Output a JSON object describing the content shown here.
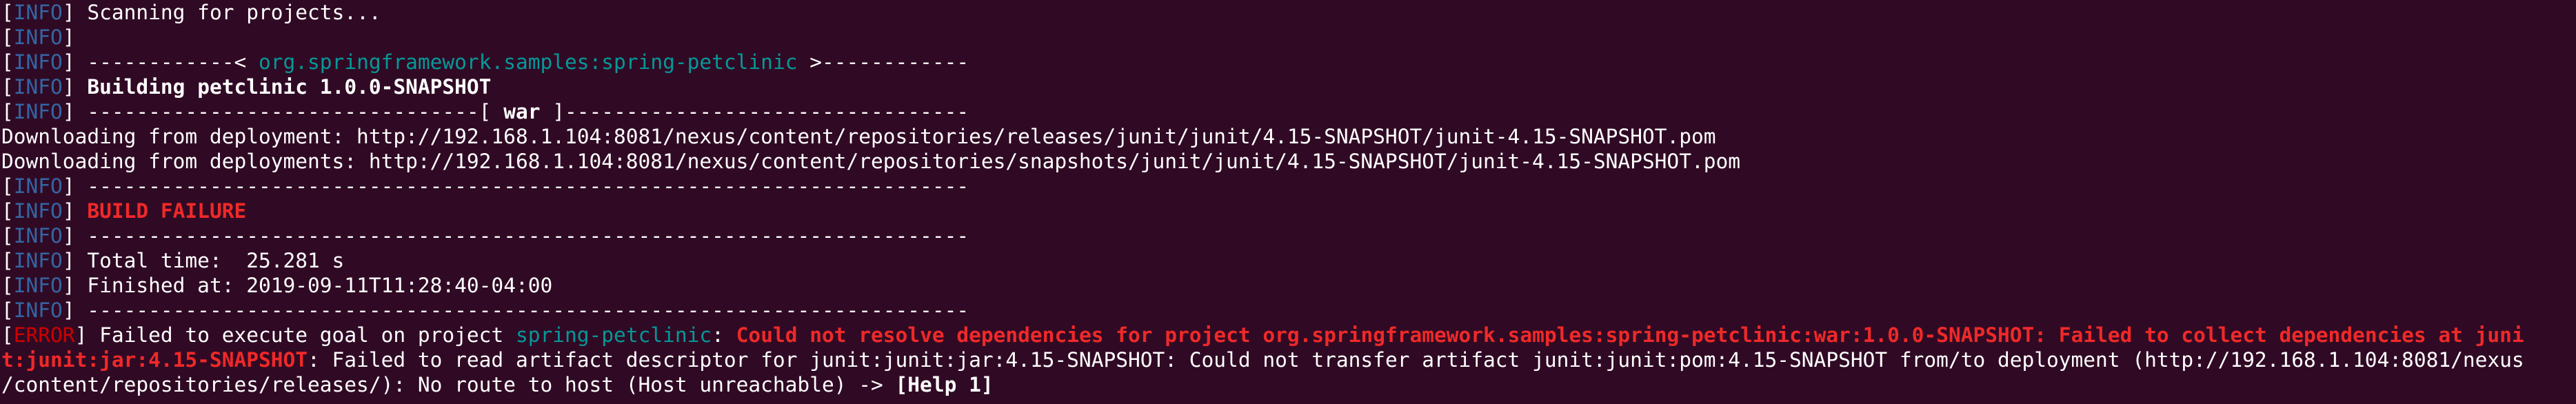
{
  "levels": {
    "info": "INFO",
    "error": "ERROR"
  },
  "colors": {
    "background": "#300a24",
    "info": "#3465a4",
    "error": "#cc0000",
    "cyan": "#06989a",
    "error_bold": "#ef2929"
  },
  "lines": {
    "l0_text": " Scanning for projects...",
    "l1_text": "",
    "l2_dash_a": " ------------< ",
    "l2_artifact": "org.springframework.samples:spring-petclinic",
    "l2_dash_b": " >------------",
    "l3_prefix": " ",
    "l3_bold": "Building petclinic 1.0.0-SNAPSHOT",
    "l4_dash_a": " --------------------------------[ ",
    "l4_war": "war",
    "l4_dash_b": " ]---------------------------------",
    "l5_text": "Downloading from deployment: http://192.168.1.104:8081/nexus/content/repositories/releases/junit/junit/4.15-SNAPSHOT/junit-4.15-SNAPSHOT.pom",
    "l6_text": "Downloading from deployments: http://192.168.1.104:8081/nexus/content/repositories/snapshots/junit/junit/4.15-SNAPSHOT/junit-4.15-SNAPSHOT.pom",
    "l7_text": " ------------------------------------------------------------------------",
    "l8_prefix": " ",
    "l8_bold": "BUILD FAILURE",
    "l9_text": " ------------------------------------------------------------------------",
    "l10_text": " Total time:  25.281 s",
    "l11_text": " Finished at: 2019-09-11T11:28:40-04:00",
    "l12_text": " ------------------------------------------------------------------------",
    "l13_a": " Failed to execute goal on project ",
    "l13_project": "spring-petclinic",
    "l13_b": ": ",
    "l13_bold": "Could not resolve dependencies for project org.springframework.samples:spring-petclinic:war:1.0.0-SNAPSHOT: Failed to collect dependencies at juni",
    "l14_bold": "t:junit:jar:4.15-SNAPSHOT",
    "l14_text": ": Failed to read artifact descriptor for junit:junit:jar:4.15-SNAPSHOT: Could not transfer artifact junit:junit:pom:4.15-SNAPSHOT from/to deployment (http://192.168.1.104:8081/nexus",
    "l15_text": "/content/repositories/releases/): No route to host (Host unreachable) -> ",
    "l15_help": "[Help 1]"
  }
}
